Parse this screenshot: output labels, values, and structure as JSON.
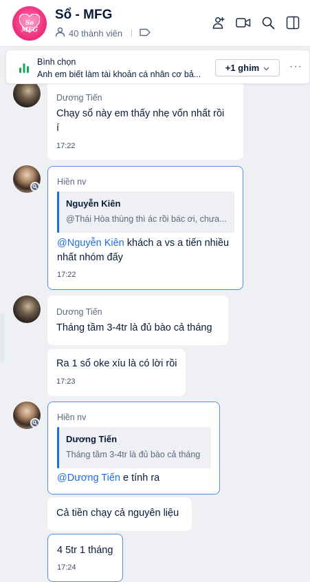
{
  "header": {
    "title": "Sổ - MFG",
    "members": "40 thành viên",
    "avatar_text": "So MFG"
  },
  "pinned": {
    "title": "Bình chọn",
    "subtitle": "Anh em biết làm tài khoản cá nhân cơ bả...",
    "button": "+1 ghim"
  },
  "messages": {
    "m1": {
      "sender": "Dương Tiến",
      "line1": "Chạy sổ này em thấy nhẹ vốn nhất rồi",
      "line2": "í",
      "time": "17:22"
    },
    "m2": {
      "sender": "Hiền nv",
      "quote_name": "Nguyễn Kiên",
      "quote_text": "@Thái Hòa thùng thì ác rồi bác ơi, chưa...",
      "mention": "@Nguyễn Kiên",
      "rest1": " khách a vs a tiến nhiều",
      "line2": "nhất nhóm đấy",
      "time": "17:22"
    },
    "m3": {
      "sender": "Dương Tiến",
      "text": "Tháng tầm 3-4tr là đủ bào cả tháng"
    },
    "m4": {
      "text": "Ra 1 sổ oke xíu là có lời rồi",
      "time": "17:23"
    },
    "m5": {
      "sender": "Hiền nv",
      "quote_name": "Dương Tiến",
      "quote_text": "Tháng tầm 3-4tr là đủ bào cả tháng",
      "mention": "@Dương Tiến",
      "rest": " e tính ra"
    },
    "m6": {
      "text": "Cả tiền chạy cả nguyên liệu"
    },
    "m7": {
      "text": "4 5tr 1 tháng",
      "time": "17:24"
    }
  }
}
